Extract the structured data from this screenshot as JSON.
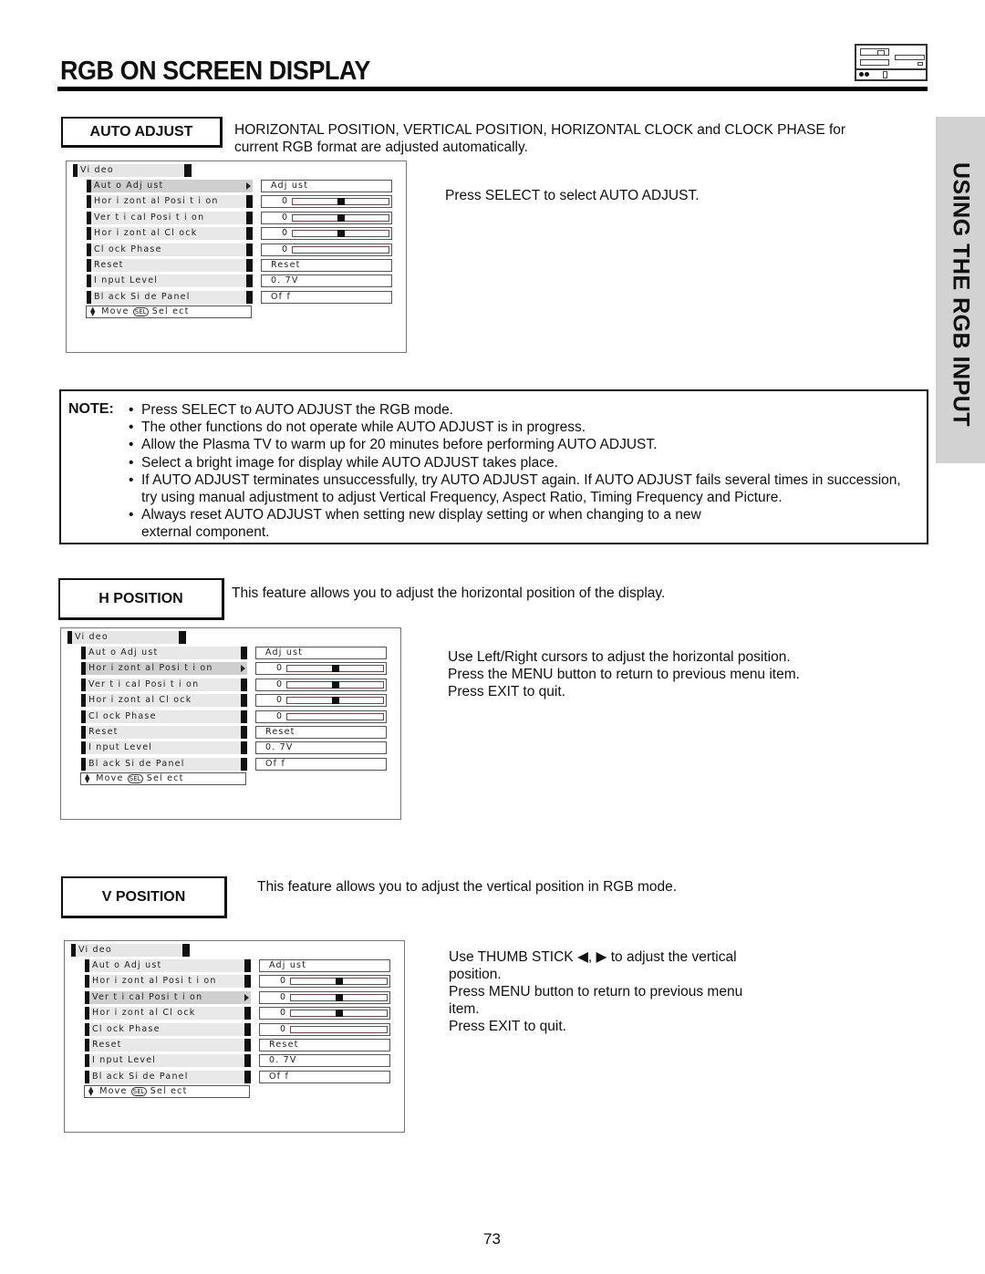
{
  "header": {
    "title": "RGB ON SCREEN DISPLAY",
    "icon": "tv-device-icon"
  },
  "side_tab": {
    "label": "USING THE RGB INPUT"
  },
  "sections": [
    {
      "label": "AUTO ADJUST",
      "description": "HORIZONTAL POSITION, VERTICAL POSITION, HORIZONTAL CLOCK and CLOCK PHASE for current RGB format are adjusted automatically.",
      "instructions": [
        "Press SELECT to select AUTO ADJUST."
      ],
      "selected_index": 0
    },
    {
      "label": "H POSITION",
      "description": "This feature allows you to adjust the horizontal position of the display.",
      "instructions": [
        "Use Left/Right cursors to adjust the horizontal position.",
        "Press the MENU button to return to previous menu item.",
        "Press EXIT to quit."
      ],
      "selected_index": 1
    },
    {
      "label": "V POSITION",
      "description": "This feature allows you to adjust the vertical position in RGB mode.",
      "instructions": [
        "Use THUMB STICK ◀, ▶ to adjust the vertical position.",
        "Press MENU button to return to previous menu item.",
        "Press EXIT to quit."
      ],
      "selected_index": 2
    }
  ],
  "osd_menu": {
    "header": "Vi deo",
    "items": [
      {
        "label": "Aut o  Adj ust",
        "value": "Adj ust",
        "type": "text"
      },
      {
        "label": "Hor i zont al   Posi t i on",
        "value": "0",
        "type": "slider",
        "level": 0.5
      },
      {
        "label": "Ver t i cal   Posi t i on",
        "value": "0",
        "type": "slider",
        "level": 0.5
      },
      {
        "label": "Hor i zont al   Cl ock",
        "value": "0",
        "type": "slider",
        "level": 0.5
      },
      {
        "label": "Cl ock  Phase",
        "value": "0",
        "type": "slider-empty"
      },
      {
        "label": "Reset",
        "value": "Reset",
        "type": "text"
      },
      {
        "label": "I nput   Level",
        "value": "0. 7V",
        "type": "text"
      },
      {
        "label": "Bl ack  Si de  Panel",
        "value": "Of f",
        "type": "text"
      }
    ],
    "footer": {
      "move_label": "Move",
      "select_chip": "SEL",
      "select_label": "Sel ect"
    }
  },
  "note": {
    "label": "NOTE:",
    "items": [
      "Press SELECT to AUTO ADJUST the RGB mode.",
      "The other functions do not operate while AUTO ADJUST is in progress.",
      "Allow the Plasma TV to warm up for 20 minutes before performing AUTO ADJUST.",
      "Select a bright image for display while AUTO ADJUST takes place.",
      "If AUTO ADJUST terminates unsuccessfully, try AUTO ADJUST again.  If AUTO ADJUST fails several times in succession, try using manual adjustment to adjust Vertical Frequency, Aspect Ratio, Timing Frequency and Picture.",
      "Always reset AUTO ADJUST when setting new display setting or when changing to a new external component."
    ]
  },
  "page_number": "73"
}
